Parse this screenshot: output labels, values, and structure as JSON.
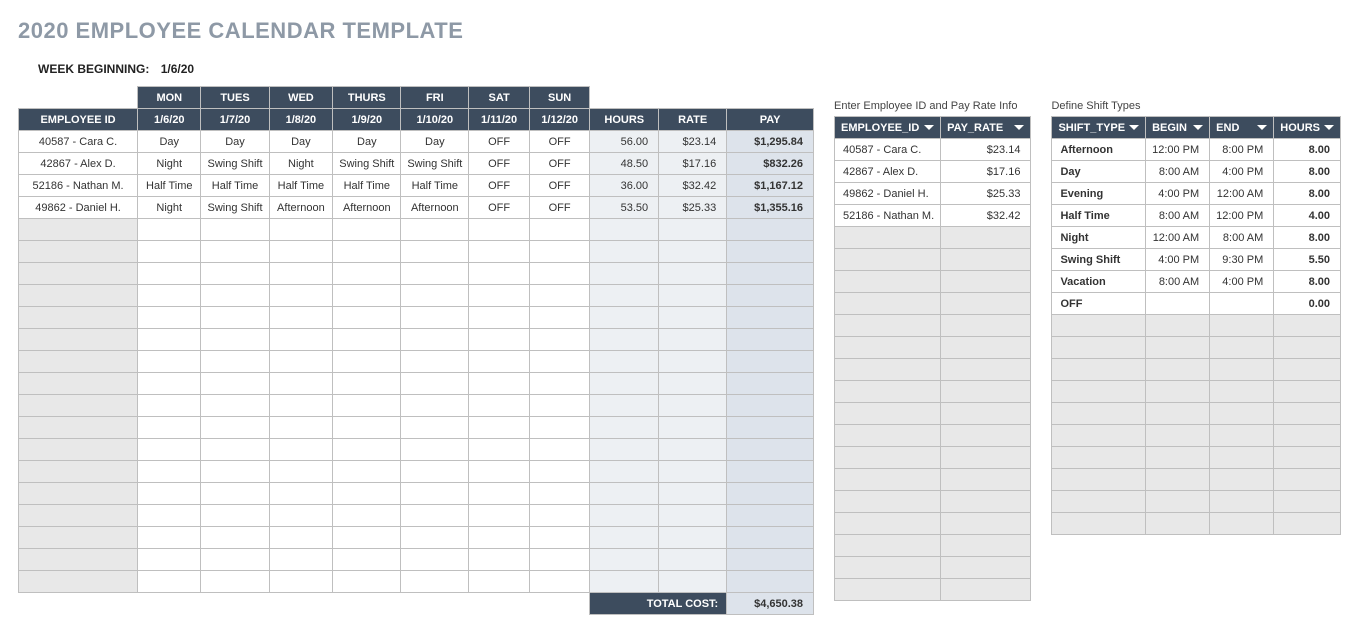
{
  "title": "2020 EMPLOYEE CALENDAR TEMPLATE",
  "week_label": "WEEK BEGINNING:",
  "week_value": "1/6/20",
  "main": {
    "day_headers": [
      "MON",
      "TUES",
      "WED",
      "THURS",
      "FRI",
      "SAT",
      "SUN"
    ],
    "date_headers": [
      "1/6/20",
      "1/7/20",
      "1/8/20",
      "1/9/20",
      "1/10/20",
      "1/11/20",
      "1/12/20"
    ],
    "emp_header": "EMPLOYEE ID",
    "metric_headers": [
      "HOURS",
      "RATE",
      "PAY"
    ],
    "rows": [
      {
        "emp": "40587 - Cara C.",
        "shifts": [
          "Day",
          "Day",
          "Day",
          "Day",
          "Day",
          "OFF",
          "OFF"
        ],
        "hours": "56.00",
        "rate": "$23.14",
        "pay": "$1,295.84"
      },
      {
        "emp": "42867 - Alex D.",
        "shifts": [
          "Night",
          "Swing Shift",
          "Night",
          "Swing Shift",
          "Swing Shift",
          "OFF",
          "OFF"
        ],
        "hours": "48.50",
        "rate": "$17.16",
        "pay": "$832.26"
      },
      {
        "emp": "52186 - Nathan M.",
        "shifts": [
          "Half Time",
          "Half Time",
          "Half Time",
          "Half Time",
          "Half Time",
          "OFF",
          "OFF"
        ],
        "hours": "36.00",
        "rate": "$32.42",
        "pay": "$1,167.12"
      },
      {
        "emp": "49862 - Daniel H.",
        "shifts": [
          "Night",
          "Swing Shift",
          "Afternoon",
          "Afternoon",
          "Afternoon",
          "OFF",
          "OFF"
        ],
        "hours": "53.50",
        "rate": "$25.33",
        "pay": "$1,355.16"
      }
    ],
    "empty_rows": 17,
    "total_label": "TOTAL COST:",
    "total_value": "$4,650.38"
  },
  "ref": {
    "caption": "Enter Employee ID and Pay Rate Info",
    "headers": [
      "EMPLOYEE_ID",
      "PAY_RATE"
    ],
    "rows": [
      {
        "id": "40587 - Cara C.",
        "rate": "$23.14"
      },
      {
        "id": "42867 - Alex D.",
        "rate": "$17.16"
      },
      {
        "id": "49862 - Daniel H.",
        "rate": "$25.33"
      },
      {
        "id": "52186 - Nathan M.",
        "rate": "$32.42"
      }
    ],
    "empty_rows": 17
  },
  "shifts": {
    "caption": "Define Shift Types",
    "headers": [
      "SHIFT_TYPE",
      "BEGIN",
      "END",
      "HOURS"
    ],
    "rows": [
      {
        "type": "Afternoon",
        "begin": "12:00 PM",
        "end": "8:00 PM",
        "hours": "8.00"
      },
      {
        "type": "Day",
        "begin": "8:00 AM",
        "end": "4:00 PM",
        "hours": "8.00"
      },
      {
        "type": "Evening",
        "begin": "4:00 PM",
        "end": "12:00 AM",
        "hours": "8.00"
      },
      {
        "type": "Half Time",
        "begin": "8:00 AM",
        "end": "12:00 PM",
        "hours": "4.00"
      },
      {
        "type": "Night",
        "begin": "12:00 AM",
        "end": "8:00 AM",
        "hours": "8.00"
      },
      {
        "type": "Swing Shift",
        "begin": "4:00 PM",
        "end": "9:30 PM",
        "hours": "5.50"
      },
      {
        "type": "Vacation",
        "begin": "8:00 AM",
        "end": "4:00 PM",
        "hours": "8.00"
      },
      {
        "type": "OFF",
        "begin": "",
        "end": "",
        "hours": "0.00"
      }
    ],
    "empty_rows": 10
  }
}
